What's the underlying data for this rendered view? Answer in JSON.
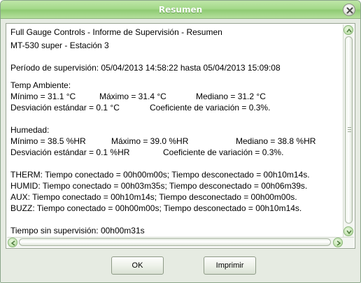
{
  "window": {
    "title": "Resumen"
  },
  "report": {
    "header_line1": "Full Gauge Controls - Informe de Supervisión - Resumen",
    "header_line2": "MT-530 super - Estación 3",
    "period": "Período de supervisión: 05/04/2013 14:58:22 hasta 05/04/2013 15:09:08",
    "temp": {
      "heading": "Temp Ambiente:",
      "min": "Mínimo = 31.1 °C",
      "max": "Máximo = 31.4 °C",
      "median": "Mediano = 31.2 °C",
      "stddev": "Desviación estándar = 0.1 °C",
      "cv": "Coeficiente de variación = 0.3%."
    },
    "humidity": {
      "heading": "Humedad:",
      "min": "Mínimo = 38.5 %HR",
      "max": "Máximo = 39.0 %HR",
      "median": "Mediano = 38.8 %HR",
      "stddev": "Desviación estándar = 0.1 %HR",
      "cv": "Coeficiente de variación = 0.3%."
    },
    "outputs": [
      "THERM: Tiempo conectado = 00h00m00s; Tiempo desconectado = 00h10m14s.",
      "HUMID: Tiempo conectado = 00h03m35s; Tiempo desconectado = 00h06m39s.",
      "AUX: Tiempo conectado = 00h10m14s; Tiempo desconectado = 00h00m00s.",
      "BUZZ: Tiempo conectado = 00h00m00s; Tiempo desconectado = 00h10m14s."
    ],
    "unsupervised": "Tiempo sin supervisión: 00h00m31s"
  },
  "buttons": {
    "ok": "OK",
    "print": "Imprimir"
  },
  "icons": {
    "close": "close-icon",
    "scroll_up": "arrow-up-icon",
    "scroll_down": "arrow-down-icon",
    "scroll_left": "arrow-left-icon",
    "scroll_right": "arrow-right-icon"
  },
  "colors": {
    "titlebar": "#a4d98a",
    "window_bg": "#e6ebe2",
    "scroll_arrow": "#c7e6b4"
  }
}
